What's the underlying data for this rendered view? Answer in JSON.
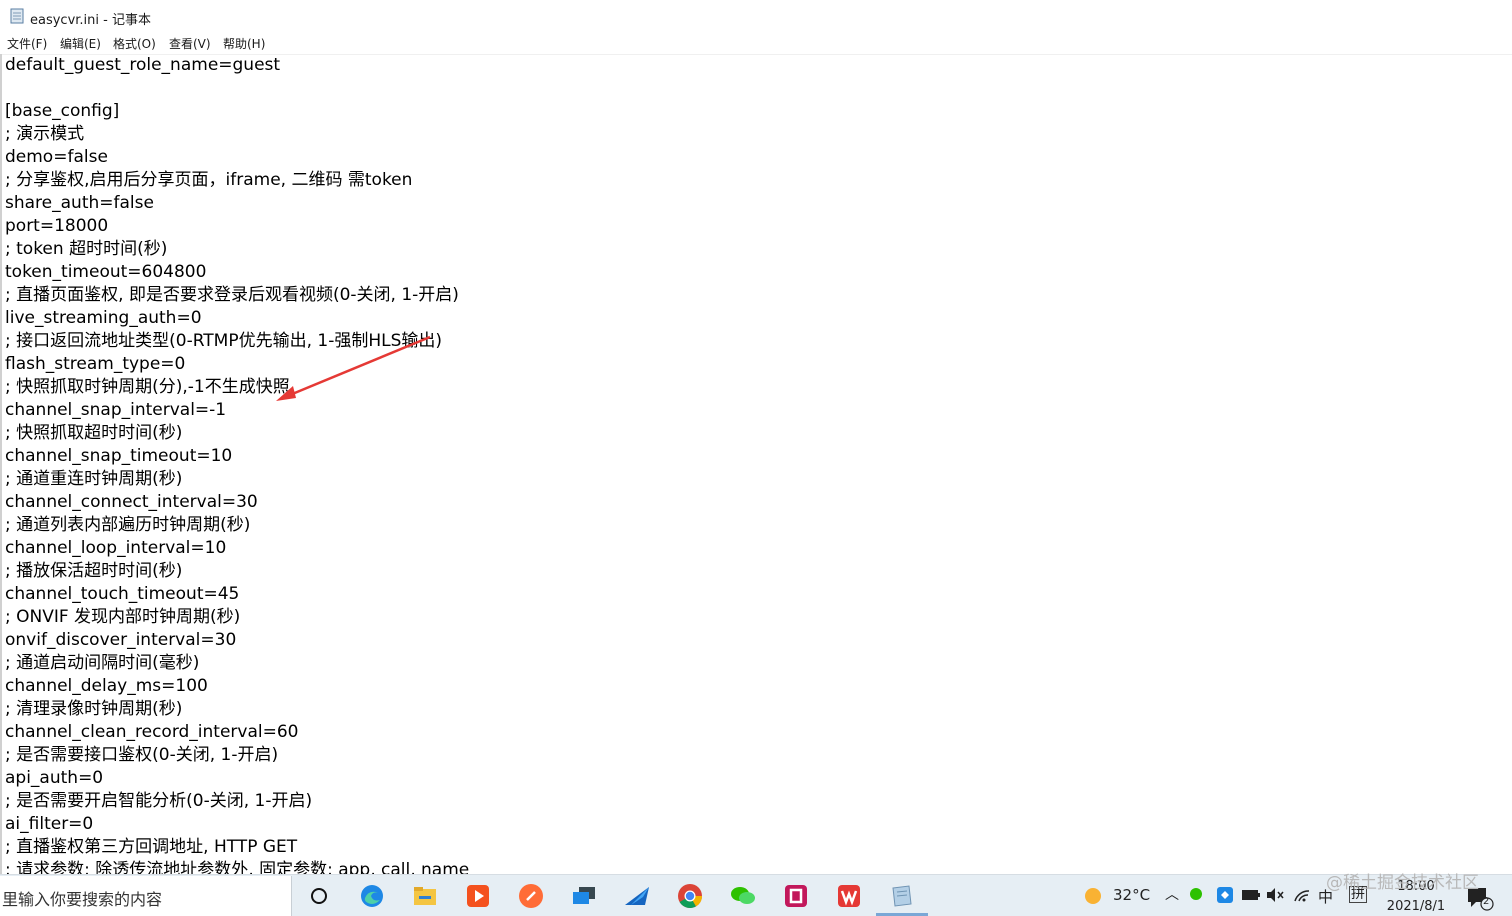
{
  "window": {
    "title": "easycvr.ini - 记事本"
  },
  "menu": [
    {
      "label": "文件(F)"
    },
    {
      "label": "编辑(E)"
    },
    {
      "label": "格式(O)"
    },
    {
      "label": "查看(V)"
    },
    {
      "label": "帮助(H)"
    }
  ],
  "editor": {
    "lines": [
      "default_guest_role_name=guest",
      "",
      "[base_config]",
      "; 演示模式",
      "demo=false",
      "; 分享鉴权,启用后分享页面，iframe, 二维码 需token",
      "share_auth=false",
      "port=18000",
      "; token 超时时间(秒)",
      "token_timeout=604800",
      "; 直播页面鉴权, 即是否要求登录后观看视频(0-关闭, 1-开启)",
      "live_streaming_auth=0",
      "; 接口返回流地址类型(0-RTMP优先输出, 1-强制HLS输出)",
      "flash_stream_type=0",
      "; 快照抓取时钟周期(分),-1不生成快照",
      "channel_snap_interval=-1",
      "; 快照抓取超时时间(秒)",
      "channel_snap_timeout=10",
      "; 通道重连时钟周期(秒)",
      "channel_connect_interval=30",
      "; 通道列表内部遍历时钟周期(秒)",
      "channel_loop_interval=10",
      "; 播放保活超时时间(秒)",
      "channel_touch_timeout=45",
      "; ONVIF 发现内部时钟周期(秒)",
      "onvif_discover_interval=30",
      "; 通道启动间隔时间(毫秒)",
      "channel_delay_ms=100",
      "; 清理录像时钟周期(秒)",
      "channel_clean_record_interval=60",
      "; 是否需要接口鉴权(0-关闭, 1-开启)",
      "api_auth=0",
      "; 是否需要开启智能分析(0-关闭, 1-开启)",
      "ai_filter=0",
      "; 直播鉴权第三方回调地址, HTTP GET",
      "; 请求参数: 除透传流地址参数外, 固定参数: app, call, name"
    ]
  },
  "taskbar": {
    "search_placeholder": "里输入你要搜索的内容",
    "apps": [
      "task-view-icon",
      "edge-icon",
      "file-explorer-icon",
      "media-player-icon",
      "postman-icon",
      "monitor-app-icon",
      "feishu-icon",
      "chrome-icon",
      "wechat-icon",
      "editor-app-icon",
      "wps-icon",
      "notepad-icon"
    ],
    "weather": "32°C",
    "ime_lang": "中",
    "ime_mode": "拼",
    "time": "18:00",
    "date": "2021/8/1",
    "notification_count": "2"
  },
  "watermark": "@稀土掘金技术社区",
  "colors": {
    "taskbar_bg": "#e6eef4",
    "arrow": "#e53935",
    "active_indicator": "#7aa7d6"
  }
}
